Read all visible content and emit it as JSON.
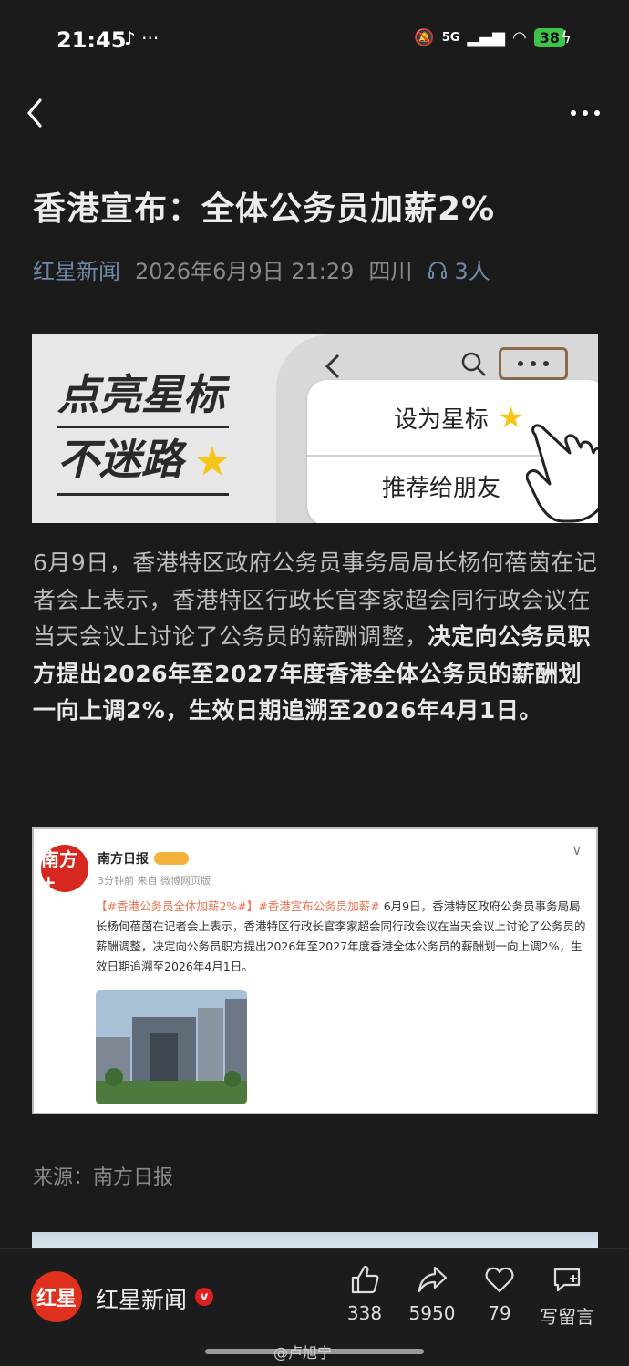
{
  "status": {
    "time": "21:45",
    "network": "5G",
    "battery": "38"
  },
  "article": {
    "title": "香港宣布：全体公务员加薪2%",
    "source_name": "红星新闻",
    "datetime": "2026年6月9日 21:29",
    "location": "四川",
    "listeners": "3人",
    "body_plain": "6月9日，香港特区政府公务员事务局局长杨何蓓茵在记者会上表示，香港特区行政长官李家超会同行政会议在当天会议上讨论了公务员的薪酬调整，",
    "body_bold": "决定向公务员职方提出2026年至2027年度香港全体公务员的薪酬划一向上调2%，生效日期追溯至2026年4月1日。",
    "credit": "来源：南方日报"
  },
  "banner": {
    "line1": "点亮星标",
    "line2": "不迷路",
    "menu_item_1": "设为星标",
    "menu_item_2": "推荐给朋友"
  },
  "weibo": {
    "avatar_text": "南方+",
    "name": "南方日报",
    "sub": "3分钟前 来自 微博网页版",
    "tag1": "【#香港公务员全体加薪2%#】",
    "tag2": "#香港宣布公务员加薪#",
    "text": "6月9日，香港特区政府公务员事务局局长杨何蓓茵在记者会上表示，香港特区行政长官李家超会同行政会议在当天会议上讨论了公务员的薪酬调整，决定向公务员职方提出2026年至2027年度香港全体公务员的薪酬划一向上调2%，生效日期追溯至2026年4月1日。"
  },
  "bottom_bar": {
    "avatar_text": "红星",
    "name": "红星新闻",
    "likes": "338",
    "shares": "5950",
    "favorites": "79",
    "comment_label": "写留言"
  },
  "watermark": "@卢旭宁",
  "colors": {
    "background": "#1b1b1b",
    "source_blue": "#6f88a8",
    "brand_red": "#e0301e",
    "battery_green": "#3ec34a"
  }
}
